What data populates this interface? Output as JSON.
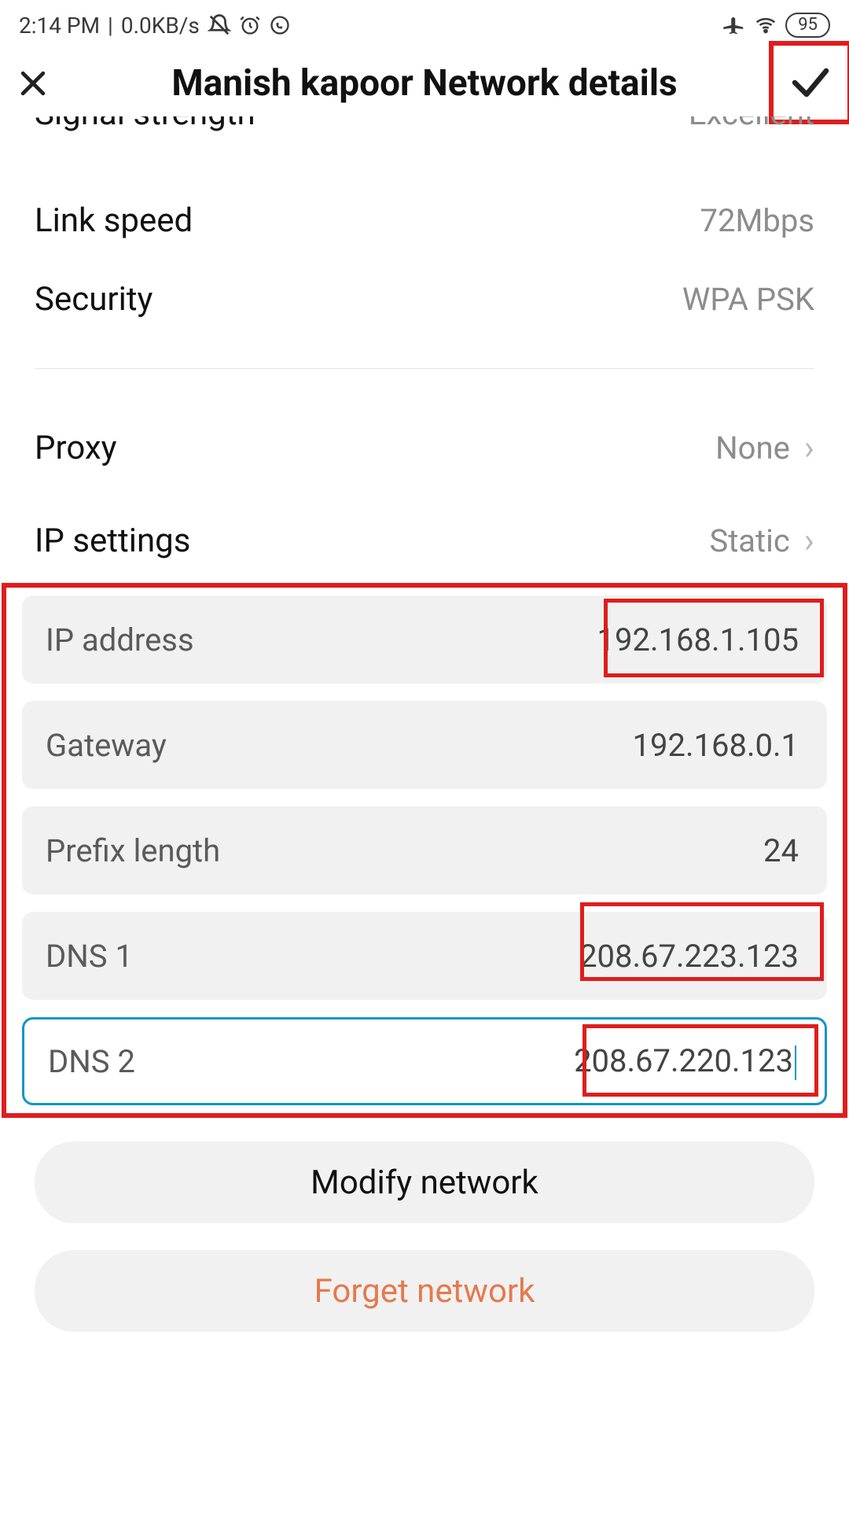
{
  "status": {
    "time": "2:14 PM",
    "net_speed": "0.0KB/s",
    "battery": "95"
  },
  "header": {
    "title": "Manish kapoor Network details"
  },
  "rows": {
    "signal_strength": {
      "label": "Signal strength",
      "value": "Excellent"
    },
    "link_speed": {
      "label": "Link speed",
      "value": "72Mbps"
    },
    "security": {
      "label": "Security",
      "value": "WPA PSK"
    },
    "proxy": {
      "label": "Proxy",
      "value": "None"
    },
    "ip_settings": {
      "label": "IP settings",
      "value": "Static"
    }
  },
  "fields": {
    "ip_address": {
      "label": "IP address",
      "value": "192.168.1.105"
    },
    "gateway": {
      "label": "Gateway",
      "value": "192.168.0.1"
    },
    "prefix_length": {
      "label": "Prefix length",
      "value": "24"
    },
    "dns1": {
      "label": "DNS 1",
      "value": "208.67.223.123"
    },
    "dns2": {
      "label": "DNS 2",
      "value": "208.67.220.123"
    }
  },
  "buttons": {
    "modify": "Modify network",
    "forget": "Forget network"
  },
  "colors": {
    "highlight_red": "#df1d1d",
    "active_blue": "#1195c9",
    "danger_text": "#e47a4d",
    "muted_text": "#8c8c8c"
  }
}
